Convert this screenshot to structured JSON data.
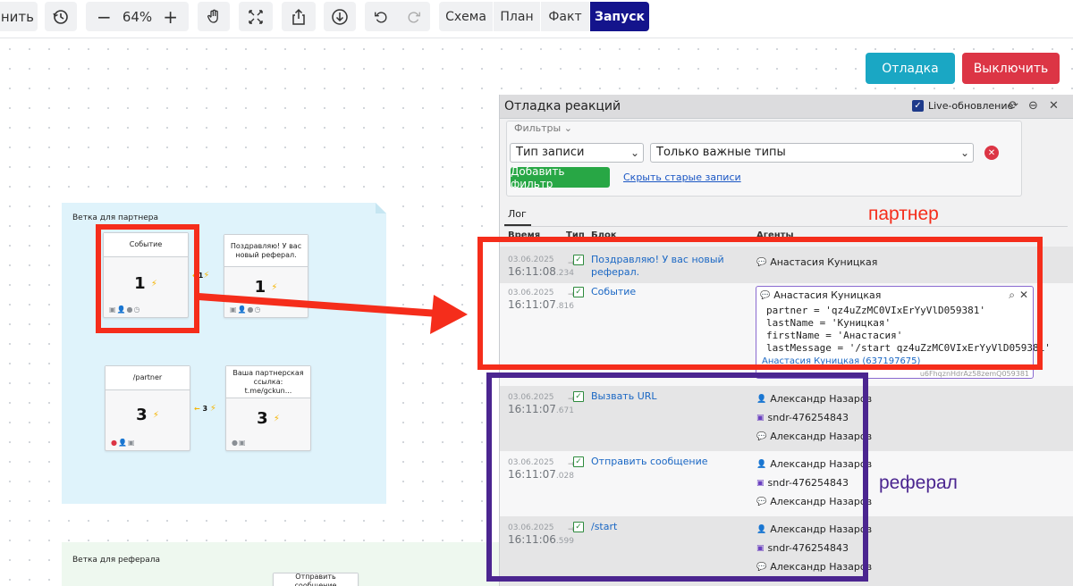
{
  "toolbar": {
    "save_partial": "анить",
    "zoom": "64%",
    "minus": "−",
    "plus": "+",
    "modes": [
      "Схема",
      "План",
      "Факт",
      "Запуск"
    ],
    "active_mode": "Запуск"
  },
  "actions": {
    "debug": "Отладка",
    "disable": "Выключить"
  },
  "canvas": {
    "branch_partner": "Ветка для партнера",
    "branch_referral": "Ветка для реферала",
    "nodes": [
      {
        "title": "Событие",
        "count": "1"
      },
      {
        "title": "Поздравляю! У вас новый реферал.",
        "count": "1"
      },
      {
        "title": "/partner",
        "count": "3"
      },
      {
        "title": "Ваша партнерская ссылка: t.me/gckun...",
        "count": "3"
      },
      {
        "title": "Отправить сообщение"
      }
    ],
    "conn1": "1",
    "conn2": "3"
  },
  "panel": {
    "title": "Отладка реакций",
    "live": "Live-обновление",
    "filters_label": "Фильтры",
    "filter_type": "Тип записи",
    "filter_value": "Только важные типы",
    "add_filter": "Добавить фильтр",
    "hide_old": "Скрыть старые записи",
    "tab_log": "Лог",
    "columns": [
      "Время",
      "Тип",
      "Блок",
      "Агенты"
    ],
    "rows": [
      {
        "date": "03.06.2025",
        "time": "16:11:08",
        "ms": ".234",
        "block": "Поздравляю! У вас новый реферал.",
        "agents": [
          "Анастасия Куницкая"
        ]
      },
      {
        "date": "03.06.2025",
        "time": "16:11:07",
        "ms": ".816",
        "block": "Событие"
      },
      {
        "date": "03.06.2025",
        "time": "16:11:07",
        "ms": ".671",
        "block": "Вызвать URL",
        "agents": [
          "Александр Назаров",
          "sndr-476254843",
          "Александр Назаров"
        ]
      },
      {
        "date": "03.06.2025",
        "time": "16:11:07",
        "ms": ".028",
        "block": "Отправить сообщение",
        "agents": [
          "Александр Назаров",
          "sndr-476254843",
          "Александр Назаров"
        ]
      },
      {
        "date": "03.06.2025",
        "time": "16:11:06",
        "ms": ".599",
        "block": "/start",
        "agents": [
          "Александр Назаров",
          "sndr-476254843",
          "Александр Назаров"
        ]
      }
    ],
    "popup": {
      "agent": "Анастасия Куницкая",
      "code": [
        "partner = 'qz4uZzMC0VIxErYyVlD059381'",
        "lastName = 'Куницкая'",
        "firstName = 'Анастасия'",
        "lastMessage = '/start qz4uZzMC0VIxErYyVlD059381'"
      ],
      "link": "Анастасия Куницкая (637197675)",
      "under": "u6FhqznHdrAz58zemQ059381"
    }
  },
  "annotations": {
    "partner": "партнер",
    "referral": "реферал",
    "red": "#f52d1b",
    "purple": "#4b2590"
  }
}
